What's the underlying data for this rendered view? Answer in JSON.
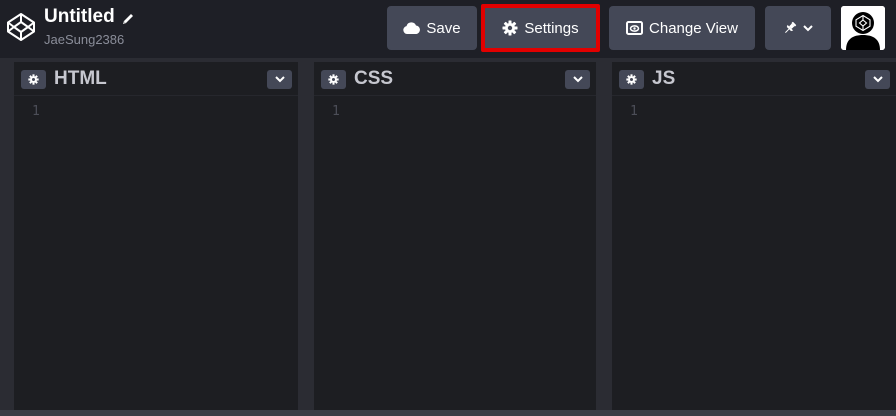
{
  "header": {
    "logo_icon": "codepen-logo-icon",
    "title": "Untitled",
    "edit_icon": "pencil-icon",
    "username": "JaeSung2386"
  },
  "toolbar": {
    "save_label": "Save",
    "save_icon": "cloud-icon",
    "settings_label": "Settings",
    "settings_icon": "gear-icon",
    "settings_highlight_color": "#e20000",
    "change_view_label": "Change View",
    "change_view_icon": "eye-layout-icon",
    "pin_icon": "pin-icon",
    "pin_dropdown_icon": "chevron-down-icon"
  },
  "avatar": {
    "icon": "user-avatar-icon"
  },
  "panels": [
    {
      "name": "HTML",
      "line_numbers": [
        "1"
      ]
    },
    {
      "name": "CSS",
      "line_numbers": [
        "1"
      ]
    },
    {
      "name": "JS",
      "line_numbers": [
        "1"
      ]
    }
  ],
  "colors": {
    "topbar": "#1e1f26",
    "button": "#444857",
    "editor": "#1d1e22",
    "separator": "#2b2c33"
  }
}
